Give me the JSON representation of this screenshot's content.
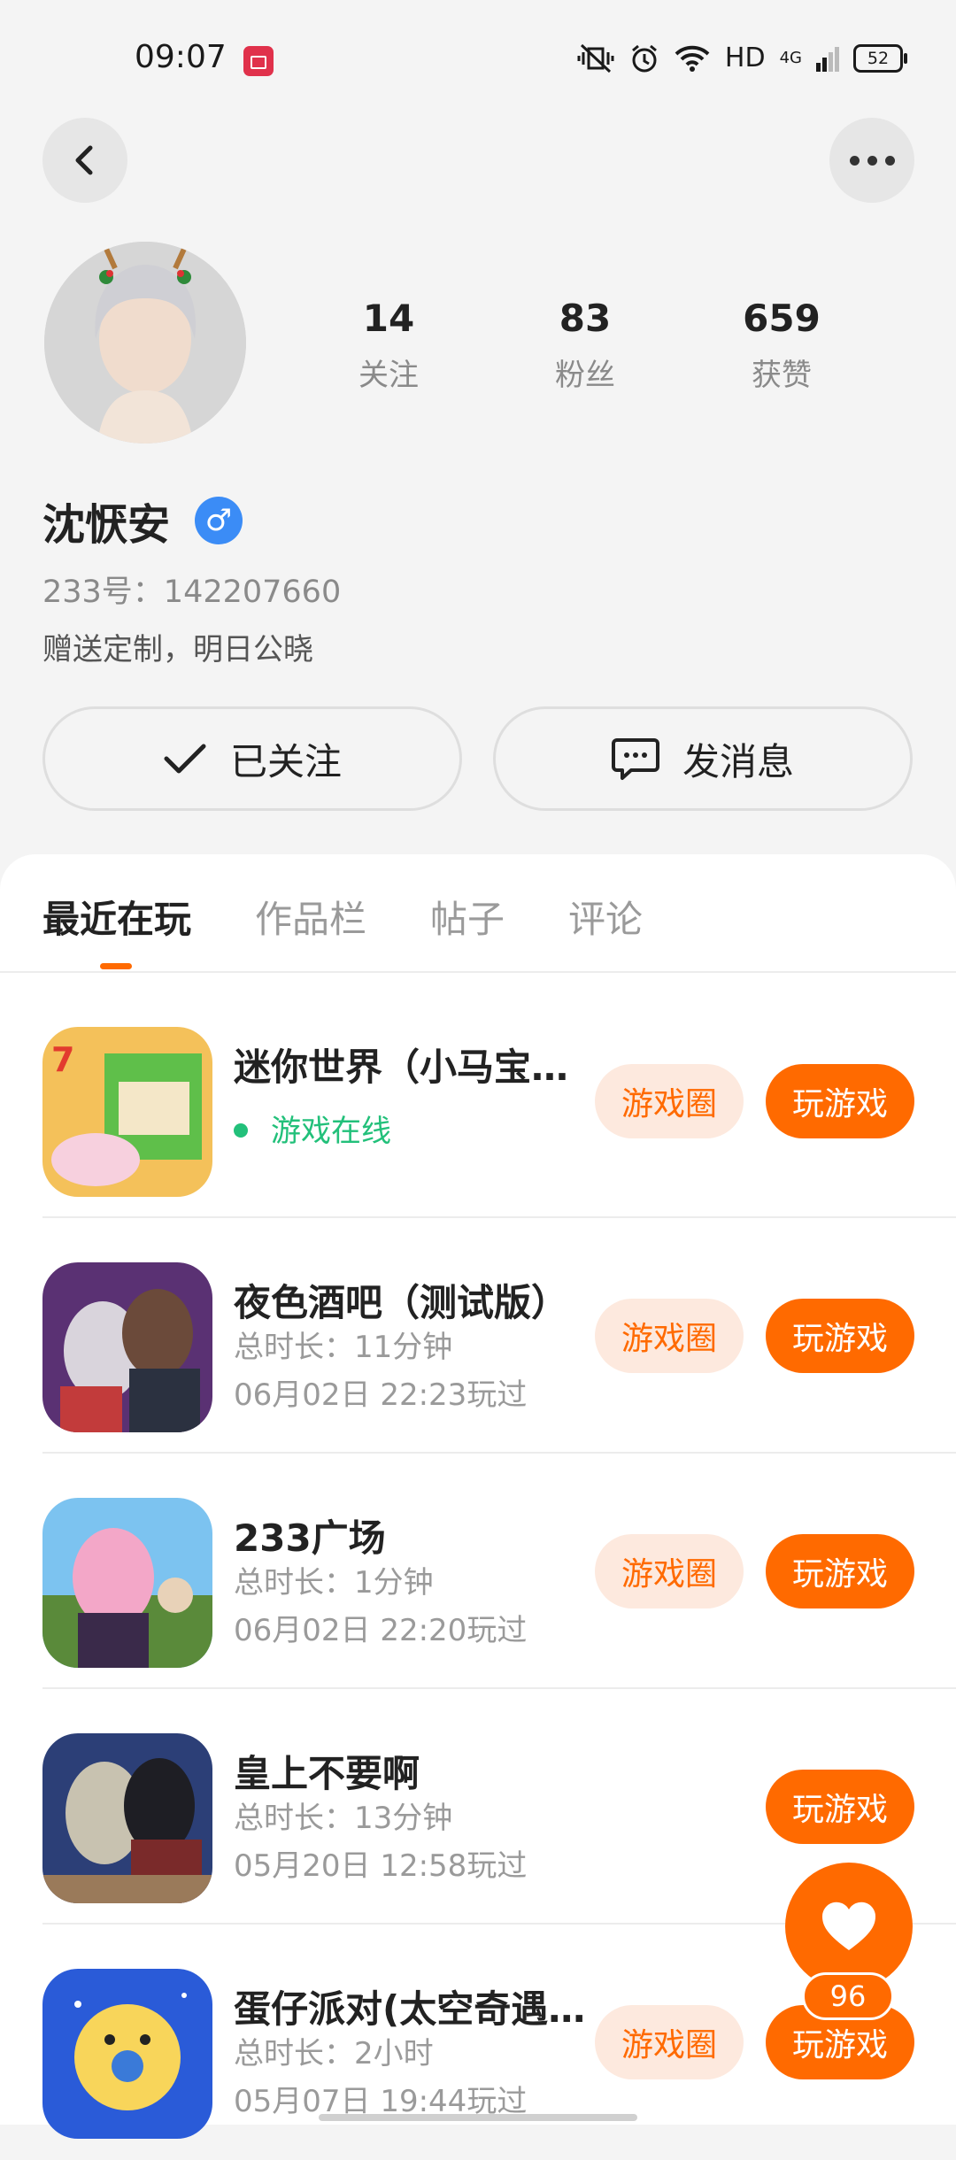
{
  "status_bar": {
    "time": "09:07",
    "network": "HD",
    "signal": "4G",
    "battery": "52"
  },
  "profile": {
    "stats": [
      {
        "value": "14",
        "label": "关注"
      },
      {
        "value": "83",
        "label": "粉丝"
      },
      {
        "value": "659",
        "label": "获赞"
      }
    ],
    "name": "沈恹安",
    "gender_symbol": "♂",
    "uid": "233号：142207660",
    "bio": "赠送定制，明日公晓",
    "follow_label": "已关注",
    "message_label": "发消息"
  },
  "tabs": [
    "最近在玩",
    "作品栏",
    "帖子",
    "评论"
  ],
  "games": [
    {
      "title": "迷你世界（小马宝…",
      "line1": "游戏在线",
      "line2": "",
      "online": true,
      "has_circle": true,
      "circle_label": "游戏圈",
      "play_label": "玩游戏",
      "icon_color": "#f2b64a"
    },
    {
      "title": "夜色酒吧（测试版）",
      "line1": "总时长：11分钟",
      "line2": "06月02日 22:23玩过",
      "online": false,
      "has_circle": true,
      "circle_label": "游戏圈",
      "play_label": "玩游戏",
      "icon_color": "#6a3a8a"
    },
    {
      "title": "233广场",
      "line1": "总时长：1分钟",
      "line2": "06月02日 22:20玩过",
      "online": false,
      "has_circle": true,
      "circle_label": "游戏圈",
      "play_label": "玩游戏",
      "icon_color": "#4aa7e8"
    },
    {
      "title": "皇上不要啊",
      "line1": "总时长：13分钟",
      "line2": "05月20日 12:58玩过",
      "online": false,
      "has_circle": false,
      "circle_label": "",
      "play_label": "玩游戏",
      "icon_color": "#2c3f77"
    },
    {
      "title": "蛋仔派对(太空奇遇…",
      "line1": "总时长：2小时",
      "line2": "05月07日 19:44玩过",
      "online": false,
      "has_circle": true,
      "circle_label": "游戏圈",
      "play_label": "玩游戏",
      "icon_color": "#2a5bd8"
    }
  ],
  "fab": {
    "count": "96"
  },
  "colors": {
    "accent": "#ff6a00",
    "accent_light": "#fde9de",
    "online": "#22c07a",
    "gender": "#3b8cf6"
  }
}
